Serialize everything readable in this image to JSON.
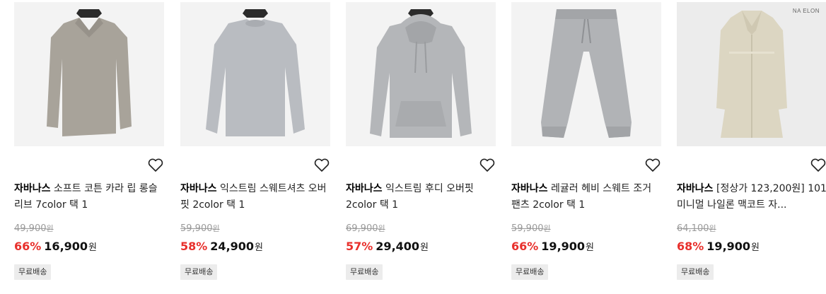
{
  "products": [
    {
      "brand": "자바나스",
      "name": "소프트 코튼 카라 립 롱슬리브 7color 택 1",
      "original_price": "49,900",
      "original_currency": "원",
      "discount": "66%",
      "sale_price": "16,900",
      "sale_currency": "원",
      "badge": "무료배송",
      "thumb_tag": "",
      "image_color": "#a8a39a",
      "image_icon": "polo-long-sleeve"
    },
    {
      "brand": "자바나스",
      "name": "익스트림 스웨트셔츠 오버핏 2color 택 1",
      "original_price": "59,900",
      "original_currency": "원",
      "discount": "58%",
      "sale_price": "24,900",
      "sale_currency": "원",
      "badge": "무료배송",
      "thumb_tag": "",
      "image_color": "#b9bcc1",
      "image_icon": "sweatshirt"
    },
    {
      "brand": "자바나스",
      "name": "익스트림 후디 오버핏 2color 택 1",
      "original_price": "69,900",
      "original_currency": "원",
      "discount": "57%",
      "sale_price": "29,400",
      "sale_currency": "원",
      "badge": "무료배송",
      "thumb_tag": "",
      "image_color": "#b4b6b9",
      "image_icon": "hoodie"
    },
    {
      "brand": "자바나스",
      "name": "레귤러 헤비 스웨트 조거 팬츠 2color 택 1",
      "original_price": "59,900",
      "original_currency": "원",
      "discount": "66%",
      "sale_price": "19,900",
      "sale_currency": "원",
      "badge": "무료배송",
      "thumb_tag": "",
      "image_color": "#b1b3b6",
      "image_icon": "jogger-pants"
    },
    {
      "brand": "자바나스",
      "name": "[정상가 123,200원] 101 미니멀 나일론 맥코트 자...",
      "original_price": "64,100",
      "original_currency": "원",
      "discount": "68%",
      "sale_price": "19,900",
      "sale_currency": "원",
      "badge": "무료배송",
      "thumb_tag": "NA ELON",
      "image_color": "#dcd6c2",
      "image_icon": "mac-coat"
    }
  ],
  "colors": {
    "discount": "#e8302c",
    "thumb_bg": "#f3f3f3",
    "badge_bg": "#ececec"
  }
}
